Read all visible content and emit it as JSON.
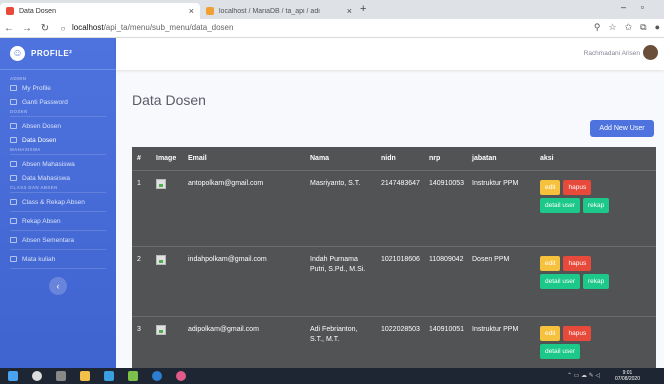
{
  "browser": {
    "tabs": [
      {
        "title": "Data Dosen",
        "active": true
      },
      {
        "title": "localhost / MariaDB / ta_api / adi",
        "active": false
      }
    ],
    "url_host": "localhost",
    "url_path": "/api_ta/menu/sub_menu/data_dosen"
  },
  "sidebar": {
    "brand": "PROFILE²",
    "sections": [
      {
        "heading": "ADMIN",
        "items": [
          "My Profile",
          "Ganti Password"
        ]
      },
      {
        "heading": "DOSEN",
        "items": [
          "Absen Dosen",
          "Data Dosen"
        ]
      },
      {
        "heading": "MAHASISWA",
        "items": [
          "Absen Mahasiswa",
          "Data Mahasiswa"
        ]
      },
      {
        "heading": "CLASS DAN ABSEN",
        "items": [
          "Class & Rekap Absen",
          "Rekap Absen",
          "Absen Sementara",
          "Mata kuliah"
        ]
      }
    ],
    "toggle": "‹"
  },
  "topbar": {
    "user_name": "Rachmadani Arisen"
  },
  "page": {
    "title": "Data Dosen",
    "add_button": "Add New User"
  },
  "table": {
    "headers": [
      "#",
      "Image",
      "Email",
      "Nama",
      "nidn",
      "nrp",
      "jabatan",
      "aksi"
    ],
    "rows": [
      {
        "no": "1",
        "email": "antopolkam@gmail.com",
        "nama": "Masriyanto, S.T.",
        "nidn": "2147483647",
        "nrp": "140910053",
        "jabatan": "Instruktur PPM"
      },
      {
        "no": "2",
        "email": "indahpolkam@gmail.com",
        "nama": "Indah Purnama Putri, S.Pd., M.Si.",
        "nidn": "1021018606",
        "nrp": "110809042",
        "jabatan": "Dosen PPM"
      },
      {
        "no": "3",
        "email": "adipolkam@gmail.com",
        "nama": "Adi Febrianton, S.T., M.T.",
        "nidn": "1022028503",
        "nrp": "140910051",
        "jabatan": "Instruktur PPM"
      }
    ],
    "actions": {
      "edit": "edit",
      "hapus": "hapus",
      "detail": "detail user",
      "rekap": "rekap"
    }
  },
  "taskbar": {
    "time": "9:01",
    "date": "07/08/2020"
  },
  "colors": {
    "sidebar": "#4e73df",
    "edit": "#f6c23e",
    "hapus": "#e74a3b",
    "detail": "#1cc88a",
    "table_bg": "#515354"
  }
}
